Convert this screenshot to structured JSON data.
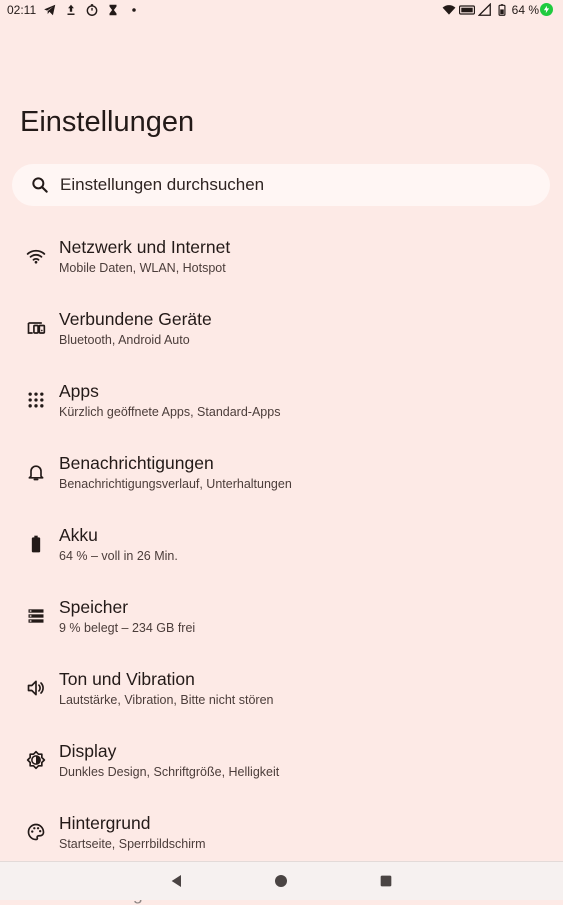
{
  "status_bar": {
    "time": "02:11",
    "battery_percent": "64 %",
    "left_icons": [
      "telegram-icon",
      "upload-icon",
      "timer-icon",
      "hourglass-icon",
      "dot-icon"
    ],
    "right_icons": [
      "wifi-icon",
      "volte-icon",
      "signal-icon",
      "battery-icon",
      "charging-icon"
    ],
    "charging_color": "#1fcb3e"
  },
  "header": {
    "title": "Einstellungen"
  },
  "search": {
    "placeholder": "Einstellungen durchsuchen",
    "icon": "search-icon"
  },
  "settings": [
    {
      "icon": "wifi-icon",
      "title": "Netzwerk und Internet",
      "subtitle": "Mobile Daten, WLAN, Hotspot"
    },
    {
      "icon": "devices-icon",
      "title": "Verbundene Geräte",
      "subtitle": "Bluetooth, Android Auto"
    },
    {
      "icon": "apps-grid-icon",
      "title": "Apps",
      "subtitle": "Kürzlich geöffnete Apps, Standard-Apps"
    },
    {
      "icon": "bell-icon",
      "title": "Benachrichtigungen",
      "subtitle": "Benachrichtigungsverlauf, Unterhaltungen"
    },
    {
      "icon": "battery-icon",
      "title": "Akku",
      "subtitle": "64 % – voll in 26 Min."
    },
    {
      "icon": "storage-icon",
      "title": "Speicher",
      "subtitle": "9 % belegt – 234 GB frei"
    },
    {
      "icon": "volume-icon",
      "title": "Ton und Vibration",
      "subtitle": "Lautstärke, Vibration, Bitte nicht stören"
    },
    {
      "icon": "brightness-icon",
      "title": "Display",
      "subtitle": "Dunkles Design, Schriftgröße, Helligkeit"
    },
    {
      "icon": "palette-icon",
      "title": "Hintergrund",
      "subtitle": "Startseite, Sperrbildschirm"
    }
  ],
  "partially_visible_item": {
    "title": "Bedienungshilfen"
  },
  "nav_bar": {
    "buttons": [
      "back-icon",
      "home-icon",
      "recents-icon"
    ]
  },
  "colors": {
    "background": "#fdeae6",
    "search_background": "#fff6f4",
    "text_primary": "#231a18",
    "text_secondary": "#4b3d3a"
  }
}
